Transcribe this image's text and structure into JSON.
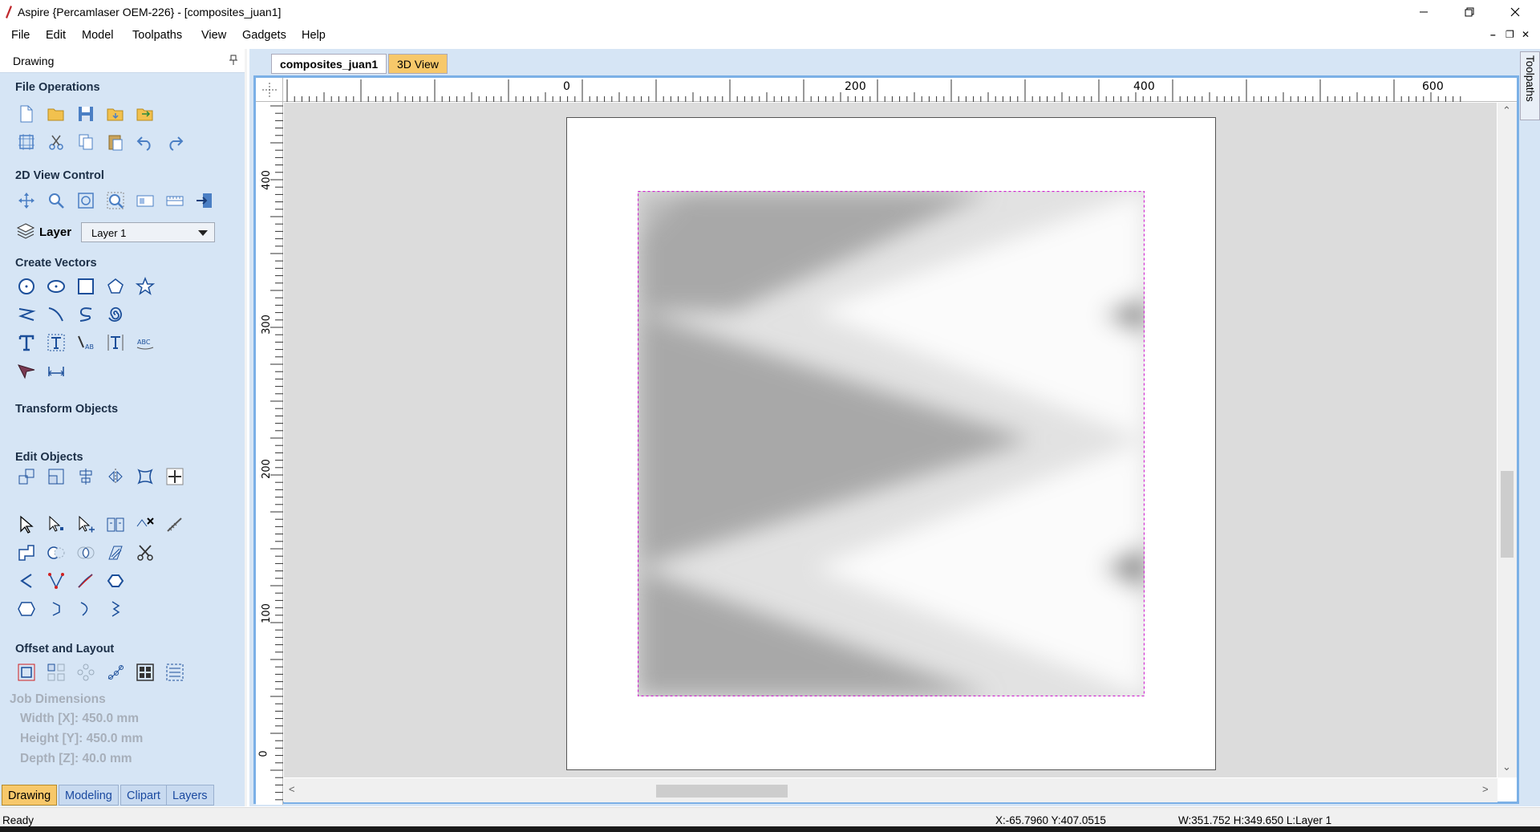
{
  "window": {
    "title": "Aspire {Percamlaser OEM-226} - [composites_juan1]"
  },
  "menu": {
    "items": [
      "File",
      "Edit",
      "Model",
      "Toolpaths",
      "View",
      "Gadgets",
      "Help"
    ]
  },
  "panel": {
    "title": "Drawing",
    "sections": {
      "file_operations": "File Operations",
      "view_control": "2D View Control",
      "create_vectors": "Create Vectors",
      "transform_objects": "Transform Objects",
      "edit_objects": "Edit Objects",
      "offset_layout": "Offset and Layout"
    },
    "layer": {
      "label": "Layer",
      "selected": "Layer 1"
    },
    "job": {
      "title": "Job Dimensions",
      "width": "Width  [X]: 450.0 mm",
      "height": "Height [Y]: 450.0 mm",
      "depth": "Depth  [Z]: 40.0 mm"
    },
    "bottom_tabs": [
      "Drawing",
      "Modeling",
      "Clipart",
      "Layers"
    ],
    "active_tab": "Drawing"
  },
  "document": {
    "tabs": [
      "composites_juan1",
      "3D View"
    ],
    "active_tab": "composites_juan1",
    "ruler_top_labels": [
      "0",
      "200",
      "400",
      "600"
    ],
    "ruler_left_labels": [
      "400",
      "300",
      "200",
      "100",
      "0"
    ],
    "side_tab": "Toolpaths"
  },
  "status": {
    "ready": "Ready",
    "coords": "X:-65.7960 Y:407.0515",
    "size": "W:351.752   H:349.650  L:Layer 1"
  },
  "colors": {
    "panel_bg": "#d6e5f5",
    "frame_accent": "#7bb0e6",
    "selection_dashes": "#d020d0",
    "active_tab": "#f7c86a"
  }
}
